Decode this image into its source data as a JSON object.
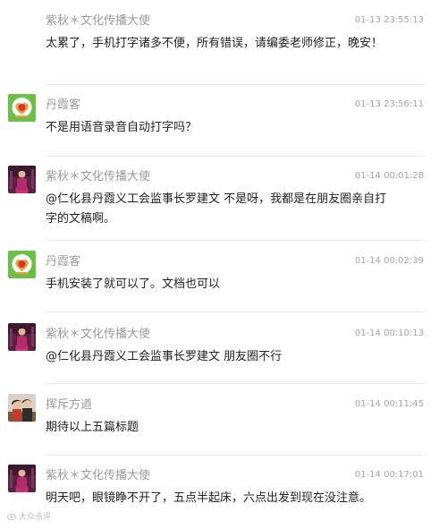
{
  "comments": [
    {
      "author": "紫秋＊文化传播大使",
      "time": "01-13 23:55:13",
      "text": "太累了，手机打字诸多不便，所有错误，请编委老师修正，晚安！",
      "avatar": "portrait-photo"
    },
    {
      "author": "丹霞客",
      "time": "01-13 23:56:11",
      "text": "不是用语音录音自动打字吗？",
      "avatar": "heart-logo"
    },
    {
      "author": "紫秋＊文化传播大使",
      "time": "01-14 00:01:28",
      "text": "@仁化县丹霞义工会监事长罗建文 不是呀，我都是在朋友圈亲自打字的文稿啊。",
      "avatar": "portrait-photo"
    },
    {
      "author": "丹霞客",
      "time": "01-14 00:02:39",
      "text": "手机安装了就可以了。文档也可以",
      "avatar": "heart-logo"
    },
    {
      "author": "紫秋＊文化传播大使",
      "time": "01-14 00:10:13",
      "text": "@仁化县丹霞义工会监事长罗建文 朋友圈不行",
      "avatar": "portrait-photo"
    },
    {
      "author": "挥斥方遒",
      "time": "01-14 00:11:45",
      "text": "期待以上五篇标题",
      "avatar": "couple-photo"
    },
    {
      "author": "紫秋＊文化传播大使",
      "time": "01-14 00:17:01",
      "text": "明天吧，眼镜睁不开了，五点半起床，六点出发到现在没注意。",
      "avatar": "portrait-photo"
    }
  ],
  "watermark": "大众点评",
  "colors": {
    "author": "#9a9a9a",
    "time": "#a3a3a3",
    "text": "#222222",
    "divider": "#ebebeb",
    "heart_logo_bg": "#6cc04a",
    "portrait_bg": "#5a2240"
  }
}
